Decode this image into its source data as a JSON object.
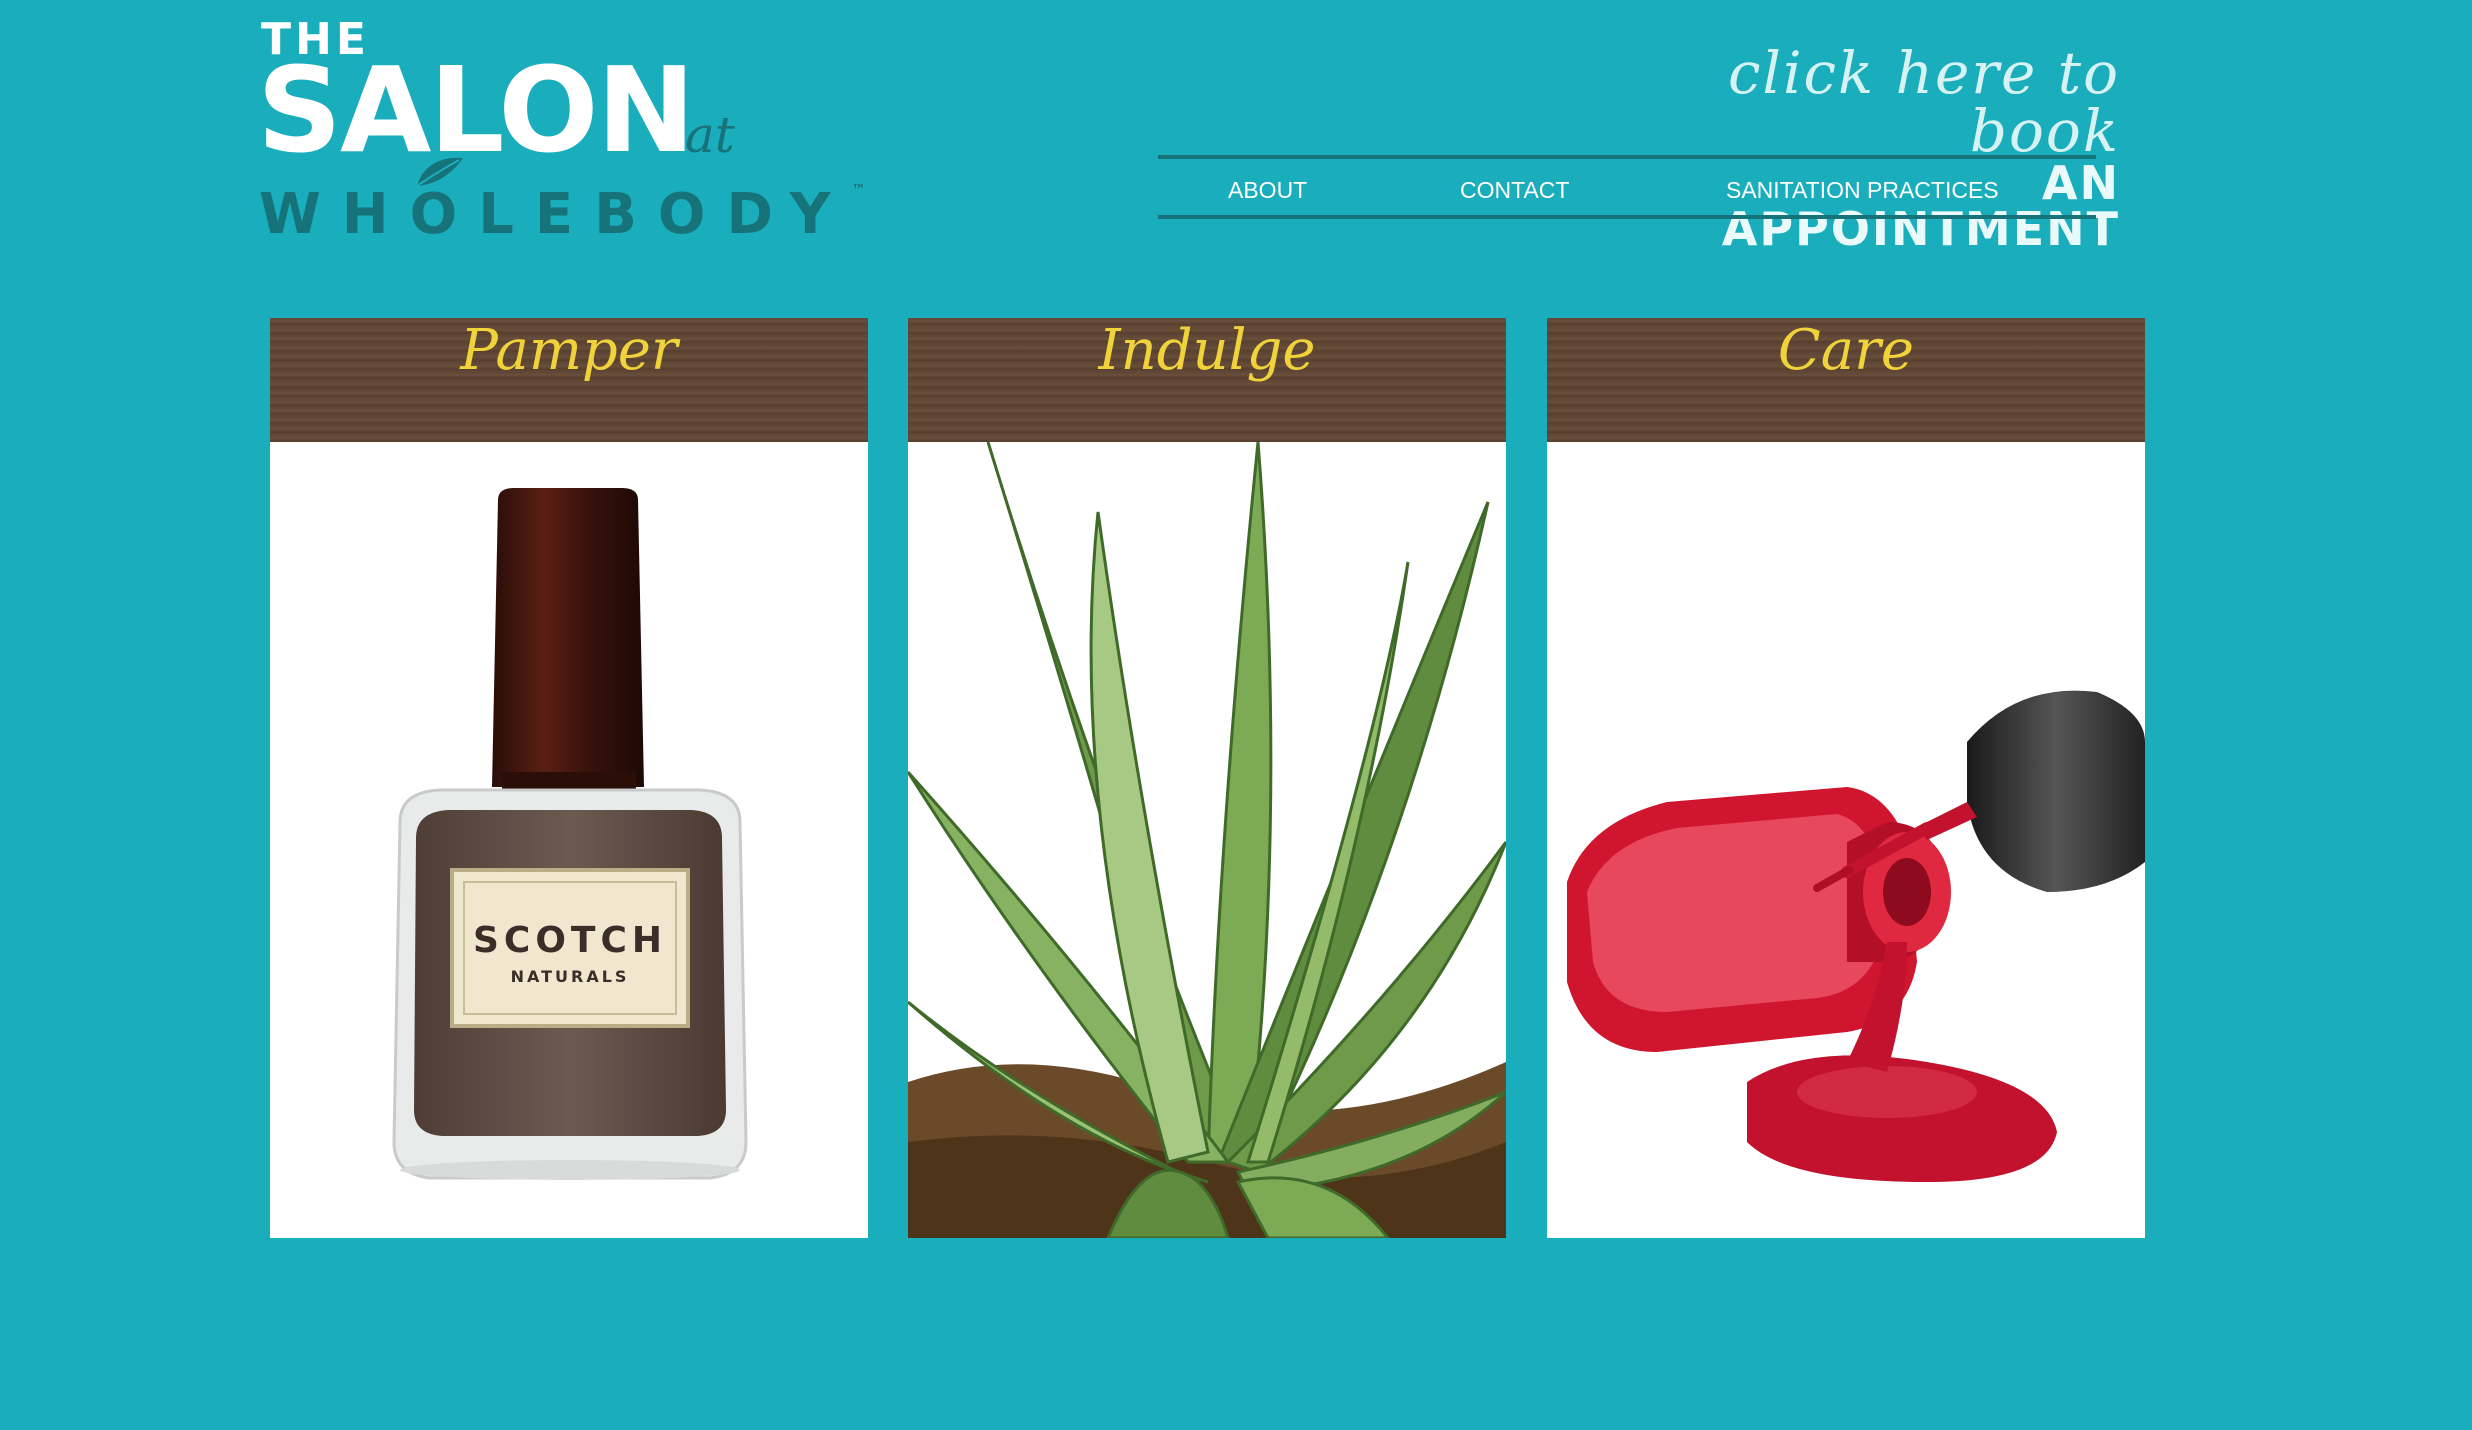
{
  "logo": {
    "the": "THE",
    "salon": "SALON",
    "at": "at",
    "whole": "WHOLE",
    "body": "BODY",
    "tm": "™"
  },
  "appointment": {
    "line1": "click here to book",
    "line2": "AN APPOINTMENT"
  },
  "nav": {
    "items": [
      "ABOUT",
      "CONTACT",
      "SANITATION PRACTICES"
    ]
  },
  "cards": [
    {
      "title": "Pamper",
      "image": "nail-polish-bottle",
      "label_brand": "SCOTCH",
      "label_sub": "NATURALS"
    },
    {
      "title": "Indulge",
      "image": "aloe-plant"
    },
    {
      "title": "Care",
      "image": "spilled-red-polish"
    }
  ],
  "colors": {
    "background": "#1aaebd",
    "logo_dark": "#17737a",
    "card_header": "#5e4633",
    "card_title": "#f0d23a"
  }
}
